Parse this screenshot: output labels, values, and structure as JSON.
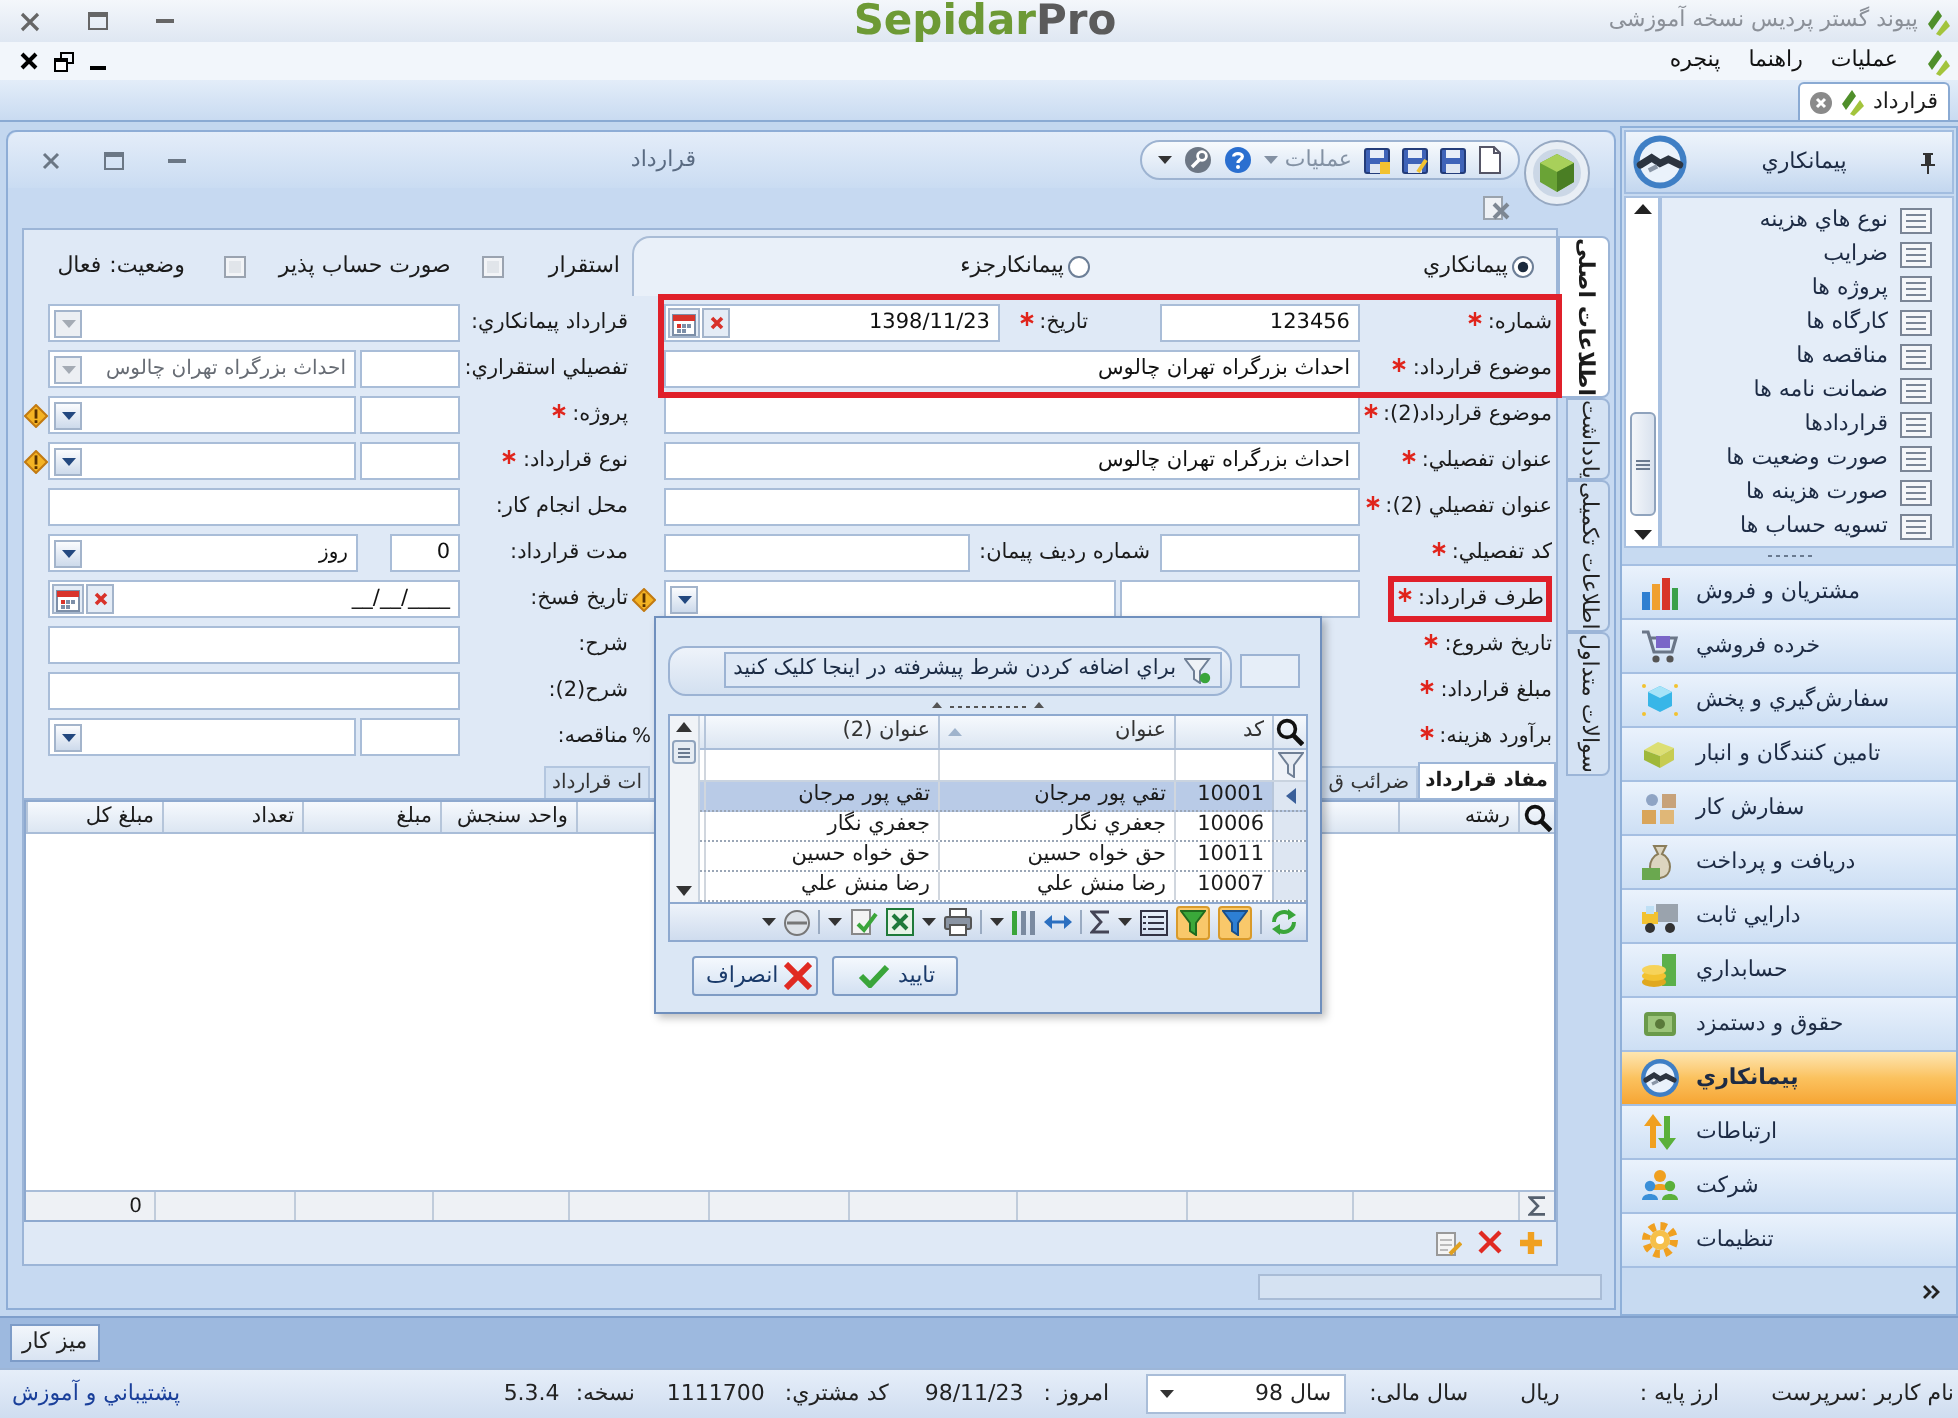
{
  "title_bar": {
    "title": "پیوند گستر پردیس نسخه آموزشی",
    "logo": {
      "name": "Sepidar",
      "suffix": "Pro"
    }
  },
  "menu_bar": {
    "items": [
      "عملیات",
      "راهنما",
      "پنجره"
    ]
  },
  "document_tabs": [
    {
      "label": "قرارداد",
      "selected": true
    }
  ],
  "navigation_pane": {
    "title": "پیمانکاري",
    "items": [
      "نوع هاي هزینه",
      "ضرایب",
      "پروژه ها",
      "کارگاه ها",
      "مناقصه ها",
      "ضمانت نامه ها",
      "قراردادها",
      "صورت وضعیت ها",
      "صورت هزینه ها",
      "تسویه حساب ها"
    ],
    "modules": [
      {
        "label": "مشتریان و فروش",
        "kind": "sales",
        "selected": false
      },
      {
        "label": "خرده فروشي",
        "kind": "retail",
        "selected": false
      },
      {
        "label": "سفارش‌گيري و پخش",
        "kind": "distribution",
        "selected": false
      },
      {
        "label": "تامین کنندگان و انبار",
        "kind": "suppliers",
        "selected": false
      },
      {
        "label": "سفارش کار",
        "kind": "work_order",
        "selected": false
      },
      {
        "label": "دریافت و پرداخت",
        "kind": "payments",
        "selected": false
      },
      {
        "label": "دارايي ثابت",
        "kind": "fixed_assets",
        "selected": false
      },
      {
        "label": "حسابداري",
        "kind": "accounting",
        "selected": false
      },
      {
        "label": "حقوق و دستمزد",
        "kind": "payroll",
        "selected": false
      },
      {
        "label": "پیمانکاري",
        "kind": "contracting",
        "selected": true
      },
      {
        "label": "ارتباطات",
        "kind": "communications",
        "selected": false
      },
      {
        "label": "شرکت",
        "kind": "company",
        "selected": false
      },
      {
        "label": "تنظیمات",
        "kind": "settings",
        "selected": false
      }
    ]
  },
  "contract_window": {
    "title": "قرارداد",
    "toolbar": {
      "menu_label": "عملیات"
    },
    "side_tabs": [
      {
        "label": "اطلاعات اصلی",
        "selected": true
      },
      {
        "label": "یادداشت",
        "selected": false
      },
      {
        "label": "اطلاعات تکمیلی",
        "selected": false
      },
      {
        "label": "سوالات متداول",
        "selected": false
      }
    ],
    "contract_type": [
      {
        "label": "پیمانکاري",
        "selected": true
      },
      {
        "label": "پیمانکارجزء",
        "selected": false
      }
    ],
    "flags": [
      {
        "label": "استقرار",
        "checked": false
      },
      {
        "label": "صورت حساب پذیر",
        "checked": false
      }
    ],
    "status": {
      "label": "وضعیت:",
      "value": "فعال"
    },
    "right_fields": [
      {
        "kind": "text_and_date",
        "label": "شماره:",
        "required": true,
        "warning": false,
        "highlighted": true,
        "label_highlighted": false,
        "value": "123456",
        "second": {
          "label": "تاریخ:",
          "required": true,
          "value": "1398/11/23"
        }
      },
      {
        "kind": "text",
        "label": "موضوع قرارداد:",
        "required": true,
        "warning": false,
        "highlighted": true,
        "label_highlighted": false,
        "value": "احداث بزرگراه تهران چالوس"
      },
      {
        "kind": "text",
        "label": "موضوع قرارداد(2):",
        "required": true,
        "warning": false,
        "highlighted": false,
        "label_highlighted": false
      },
      {
        "kind": "text",
        "label": "عنوان تفصیلي:",
        "required": true,
        "warning": false,
        "highlighted": false,
        "label_highlighted": false,
        "value": "احداث بزرگراه تهران چالوس"
      },
      {
        "kind": "text",
        "label": "عنوان تفصیلي (2):",
        "required": true,
        "warning": false,
        "highlighted": false,
        "label_highlighted": false
      },
      {
        "kind": "text_and_text",
        "label": "کد تفصیلي:",
        "required": true,
        "warning": false,
        "highlighted": false,
        "label_highlighted": false,
        "second": {
          "label": "شماره ردیف پیمان:",
          "required": false
        }
      },
      {
        "kind": "code_lookup",
        "label": "طرف قرارداد:",
        "required": true,
        "warning": true,
        "highlighted": false,
        "label_highlighted": true
      },
      {
        "kind": "covered",
        "label": "تاریخ شروع:",
        "required": true,
        "warning": false,
        "highlighted": false,
        "label_highlighted": false
      },
      {
        "kind": "covered",
        "label": "مبلغ قرارداد:",
        "required": true,
        "warning": false,
        "highlighted": false,
        "label_highlighted": false
      },
      {
        "kind": "covered",
        "label": "برآورد هزینه:",
        "required": true,
        "warning": false,
        "highlighted": false,
        "label_highlighted": false,
        "side_text": "%"
      }
    ],
    "left_fields": [
      {
        "kind": "lookup",
        "label": "قرارداد پیمانکاري:",
        "required": false,
        "warning": false,
        "disabled": true
      },
      {
        "kind": "code_lookup",
        "label": "تفصیلي استقراري:",
        "required": false,
        "warning": false,
        "disabled": true,
        "value": "احداث بزرگراه تهران چالوس"
      },
      {
        "kind": "code_lookup",
        "label": "پروژه:",
        "required": true,
        "warning": true,
        "disabled": false
      },
      {
        "kind": "code_lookup",
        "label": "نوع قرارداد:",
        "required": true,
        "warning": true,
        "disabled": false
      },
      {
        "kind": "text",
        "label": "محل انجام کار:",
        "required": false,
        "warning": false,
        "disabled": false
      },
      {
        "kind": "duration",
        "label": "مدت قرارداد:",
        "required": false,
        "warning": false,
        "disabled": false,
        "value": "0",
        "unit": "روز"
      },
      {
        "kind": "date",
        "label": "تاریخ فسخ:",
        "required": false,
        "warning": false,
        "disabled": false,
        "value": "__/__/____"
      },
      {
        "kind": "text",
        "label": "شرح:",
        "required": false,
        "warning": false,
        "disabled": false
      },
      {
        "kind": "text",
        "label": "شرح(2):",
        "required": false,
        "warning": false,
        "disabled": false
      },
      {
        "kind": "code_lookup",
        "label": "مناقصه:",
        "required": false,
        "warning": false,
        "disabled": false
      }
    ],
    "detail_tabs": [
      {
        "label": "مفاد قرارداد",
        "selected": true
      },
      {
        "label": "ضرائب ق",
        "selected": false
      },
      {
        "label": "ات قرارداد",
        "selected": false
      }
    ],
    "detail_grid": {
      "columns": [
        "رشته",
        "واحد سنجش",
        "مبلغ",
        "تعداد",
        "مبلغ کل"
      ],
      "total": "0"
    },
    "lookup_popup": {
      "filter_button": "براي اضافه کردن شرط پیشرفته در اینجا کلیک کنید",
      "columns": [
        "کد",
        "عنوان",
        "عنوان (2)"
      ],
      "rows": [
        {
          "cells": [
            "10001",
            "تقي پور مرجان",
            "تقي پور مرجان"
          ],
          "selected": true
        },
        {
          "cells": [
            "10006",
            "جعفري نگار",
            "جعفري نگار"
          ],
          "selected": false
        },
        {
          "cells": [
            "10011",
            "حق خواه حسین",
            "حق خواه حسین"
          ],
          "selected": false
        },
        {
          "cells": [
            "10007",
            "رضا منش علي",
            "رضا منش علي"
          ],
          "selected": false
        }
      ],
      "toggles": [
        {
          "on": true
        },
        {
          "on": true
        }
      ],
      "buttons": [
        {
          "label": "تایید",
          "kind": "ok"
        },
        {
          "label": "انصراف",
          "kind": "cancel"
        }
      ]
    }
  },
  "taskbar": {
    "buttons": [
      "میز کار"
    ]
  },
  "status_bar": {
    "user": "نام کاربر :سرپرست",
    "currency_label": "ارز پایه :",
    "currency": "ریال",
    "fiscal_year_label": "سال مالی:",
    "fiscal_year": "سال 98",
    "today_label": "امروز :",
    "today": "98/11/23",
    "customer_code_label": "کد مشتري:",
    "customer_code": "1111700",
    "version_label": "نسخه:",
    "version": "5.3.4",
    "support_link": "پشتيباني و آموزش"
  }
}
